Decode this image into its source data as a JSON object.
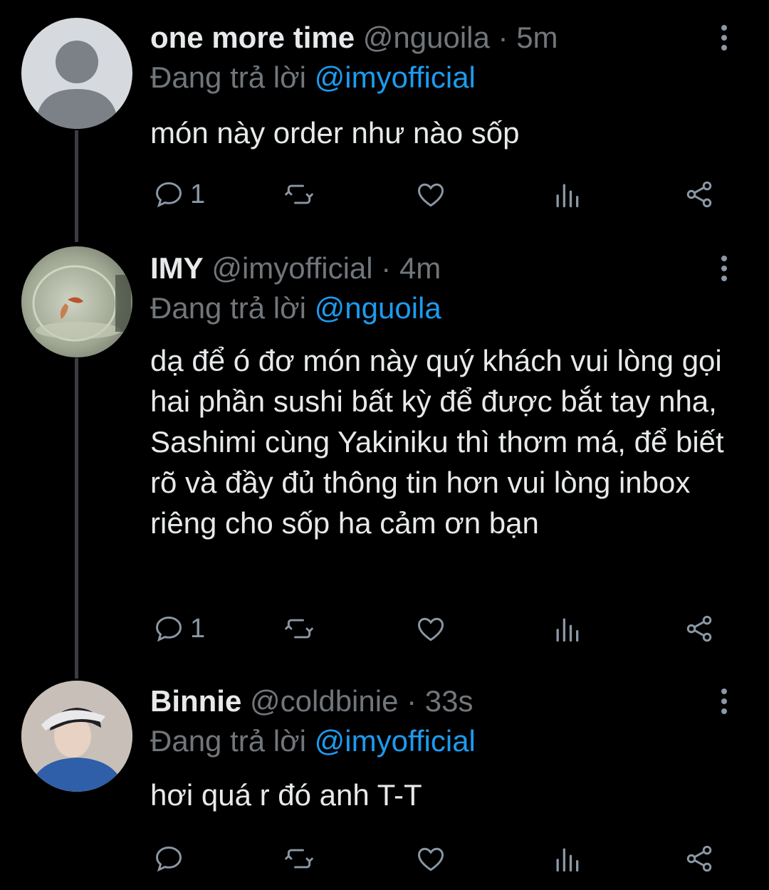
{
  "tweets": [
    {
      "name": "one more time",
      "handle": "@nguoila",
      "time": "5m",
      "replying_prefix": "Đang trả lời",
      "replying_to": "@imyofficial",
      "text": "món này order như nào sốp",
      "reply_count": "1"
    },
    {
      "name": "IMY",
      "handle": "@imyofficial",
      "time": "4m",
      "replying_prefix": "Đang trả lời",
      "replying_to": "@nguoila",
      "text": "dạ để ó đơ món này quý khách vui lòng gọi hai phần sushi bất kỳ để được bắt tay nha, Sashimi cùng Yakiniku thì thơm má, để biết rõ và đầy đủ thông tin hơn vui lòng inbox riêng cho sốp ha cảm ơn bạn",
      "reply_count": "1"
    },
    {
      "name": "Binnie",
      "handle": "@coldbinie",
      "time": "33s",
      "replying_prefix": "Đang trả lời",
      "replying_to": "@imyofficial",
      "text": "hơi quá r đó anh T-T",
      "reply_count": ""
    }
  ],
  "separator": "·",
  "colors": {
    "background": "#000000",
    "link": "#1d9bf0",
    "muted": "#71767b",
    "icon": "#8b98a5",
    "thread_line": "#3a3d41"
  }
}
